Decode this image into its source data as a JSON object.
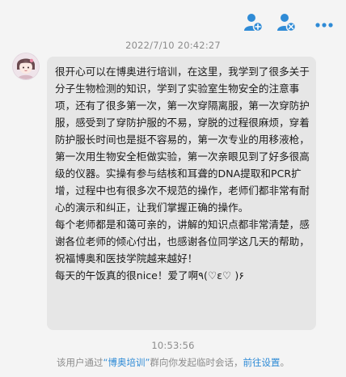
{
  "chat": {
    "timestamp_top": "2022/7/10 20:42:27",
    "timestamp_bottom": "10:53:56",
    "message_paragraphs": [
      "很开心可以在博奥进行培训，在这里，我学到了很多关于分子生物检测的知识，学到了实验室生物安全的注意事项，还有了很多第一次，第一次穿隔离服，第一次穿防护服，感受到了穿防护服的不易，穿脱的过程很麻烦，穿着防护服长时间也是挺不容易的，第一次专业的用移液枪，第一次用生物安全柜做实验，第一次亲眼见到了好多很高级的仪器。实操有参与结核和耳聋的DNA提取和PCR扩增，过程中也有很多次不规范的操作，老师们都非常有耐心的演示和纠正，让我们掌握正确的操作。",
      "每个老师都是和蔼可亲的，讲解的知识点都非常清楚，感谢各位老师的倾心付出，也感谢各位同学这几天的帮助，祝福博奥和医技学院越来越好！",
      "每天的午饭真的很nice！爱了啊٩(♡ε♡ )۶"
    ]
  },
  "notice": {
    "prefix": "该用户通过",
    "group_name": "“博奥培训”",
    "middle": "群向你发起临时会话，",
    "link": "前往设置",
    "suffix": "。"
  },
  "icons": {
    "add_member": "add-member-icon",
    "remove_member": "remove-member-icon",
    "more": "more-icon",
    "accent": "#2f8bd6"
  }
}
